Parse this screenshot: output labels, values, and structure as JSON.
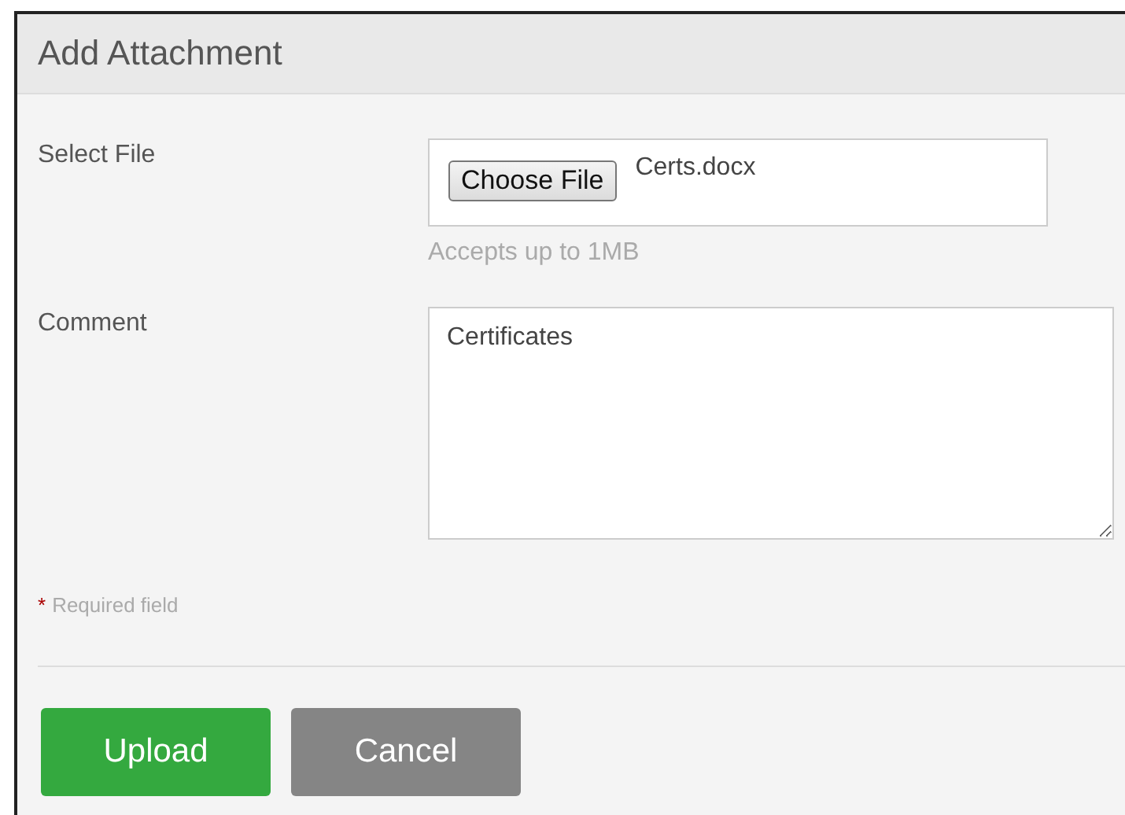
{
  "dialog": {
    "title": "Add Attachment"
  },
  "file_field": {
    "label": "Select File",
    "button": "Choose File",
    "file_name": "Certs.docx",
    "hint": "Accepts up to 1MB"
  },
  "comment_field": {
    "label": "Comment",
    "value": "Certificates"
  },
  "required_note": {
    "marker": "*",
    "text": "Required field"
  },
  "buttons": [
    {
      "label": "Upload",
      "kind": "primary"
    },
    {
      "label": "Cancel",
      "kind": "secondary"
    }
  ]
}
